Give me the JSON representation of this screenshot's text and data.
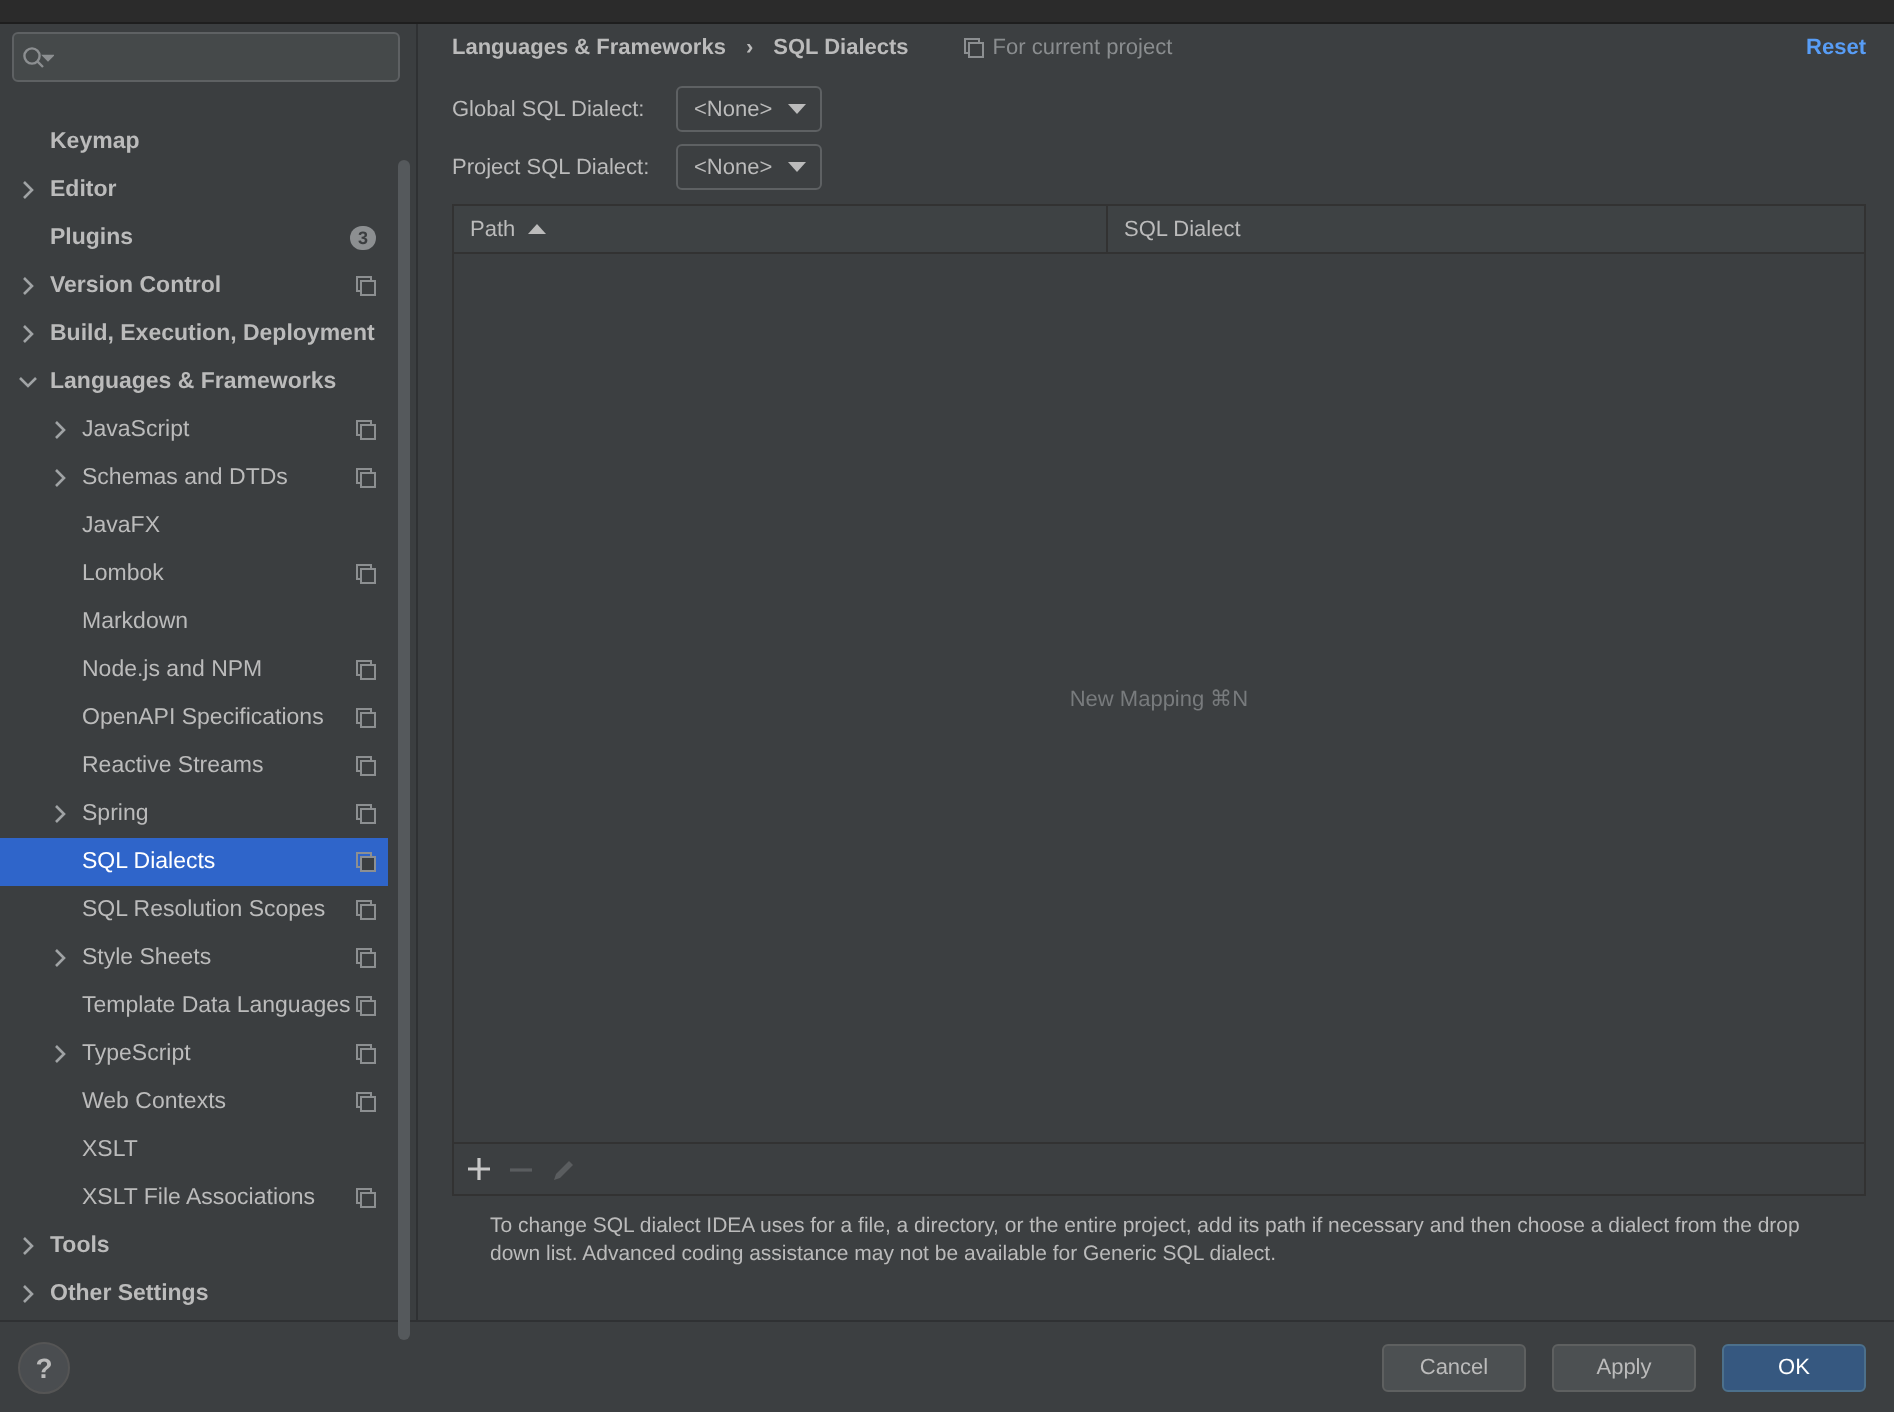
{
  "sidebar": {
    "items": [
      {
        "label": "Keymap",
        "selected": false,
        "project_scope": false
      },
      {
        "label": "Editor",
        "selected": false,
        "expanded": false,
        "project_scope": false
      },
      {
        "label": "Plugins",
        "selected": false,
        "project_scope": false,
        "badge": "3"
      },
      {
        "label": "Version Control",
        "selected": false,
        "expanded": false,
        "project_scope": true
      },
      {
        "label": "Build, Execution, Deployment",
        "selected": false,
        "expanded": false,
        "project_scope": false
      },
      {
        "label": "Languages & Frameworks",
        "selected": false,
        "expanded": true,
        "project_scope": false,
        "children": [
          {
            "label": "JavaScript",
            "selected": false,
            "expanded": false,
            "project_scope": true
          },
          {
            "label": "Schemas and DTDs",
            "selected": false,
            "expanded": false,
            "project_scope": true
          },
          {
            "label": "JavaFX",
            "selected": false,
            "project_scope": false
          },
          {
            "label": "Lombok",
            "selected": false,
            "project_scope": true
          },
          {
            "label": "Markdown",
            "selected": false,
            "project_scope": false
          },
          {
            "label": "Node.js and NPM",
            "selected": false,
            "project_scope": true
          },
          {
            "label": "OpenAPI Specifications",
            "selected": false,
            "project_scope": true
          },
          {
            "label": "Reactive Streams",
            "selected": false,
            "project_scope": true
          },
          {
            "label": "Spring",
            "selected": false,
            "expanded": false,
            "project_scope": true
          },
          {
            "label": "SQL Dialects",
            "selected": true,
            "project_scope": true
          },
          {
            "label": "SQL Resolution Scopes",
            "selected": false,
            "project_scope": true
          },
          {
            "label": "Style Sheets",
            "selected": false,
            "expanded": false,
            "project_scope": true
          },
          {
            "label": "Template Data Languages",
            "selected": false,
            "project_scope": true
          },
          {
            "label": "TypeScript",
            "selected": false,
            "expanded": false,
            "project_scope": true
          },
          {
            "label": "Web Contexts",
            "selected": false,
            "project_scope": true
          },
          {
            "label": "XSLT",
            "selected": false,
            "project_scope": false
          },
          {
            "label": "XSLT File Associations",
            "selected": false,
            "project_scope": true
          }
        ]
      },
      {
        "label": "Tools",
        "selected": false,
        "expanded": false,
        "project_scope": false
      },
      {
        "label": "Other Settings",
        "selected": false,
        "expanded": false,
        "project_scope": false
      }
    ]
  },
  "header": {
    "breadcrumbs": [
      "Languages & Frameworks",
      "SQL Dialects"
    ],
    "separator": "›",
    "scope_note": "For current project",
    "reset": "Reset"
  },
  "dialect_fields": [
    {
      "label": "Global SQL Dialect:",
      "value": "<None>"
    },
    {
      "label": "Project SQL Dialect:",
      "value": "<None>"
    }
  ],
  "table": {
    "columns": [
      {
        "label": "Path",
        "sorted": true
      },
      {
        "label": "SQL Dialect",
        "sorted": false
      }
    ],
    "empty_text": "New Mapping ⌘N"
  },
  "description": "To change SQL dialect IDEA uses for a file, a directory, or the entire project, add its path if necessary and then choose a dialect from the drop down list. Advanced coding assistance may not be available for Generic SQL dialect.",
  "footer": {
    "help": "?",
    "buttons": [
      {
        "label": "Cancel",
        "kind": "secondary"
      },
      {
        "label": "Apply",
        "kind": "secondary"
      },
      {
        "label": "OK",
        "kind": "primary"
      }
    ]
  }
}
